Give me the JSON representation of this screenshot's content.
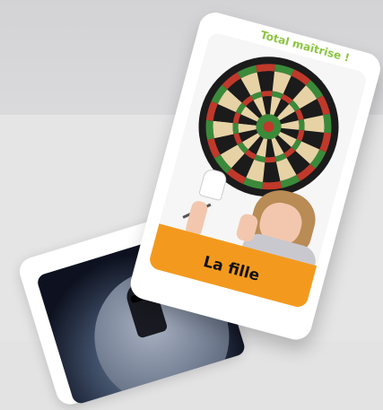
{
  "card": {
    "title": "Total maîtrise !",
    "label": "La fille"
  },
  "colors": {
    "title_green": "#8bc53f",
    "banner_orange": "#f39a1e",
    "card_white": "#ffffff"
  },
  "icons": [
    "dartboard-icon",
    "dart-icon"
  ]
}
